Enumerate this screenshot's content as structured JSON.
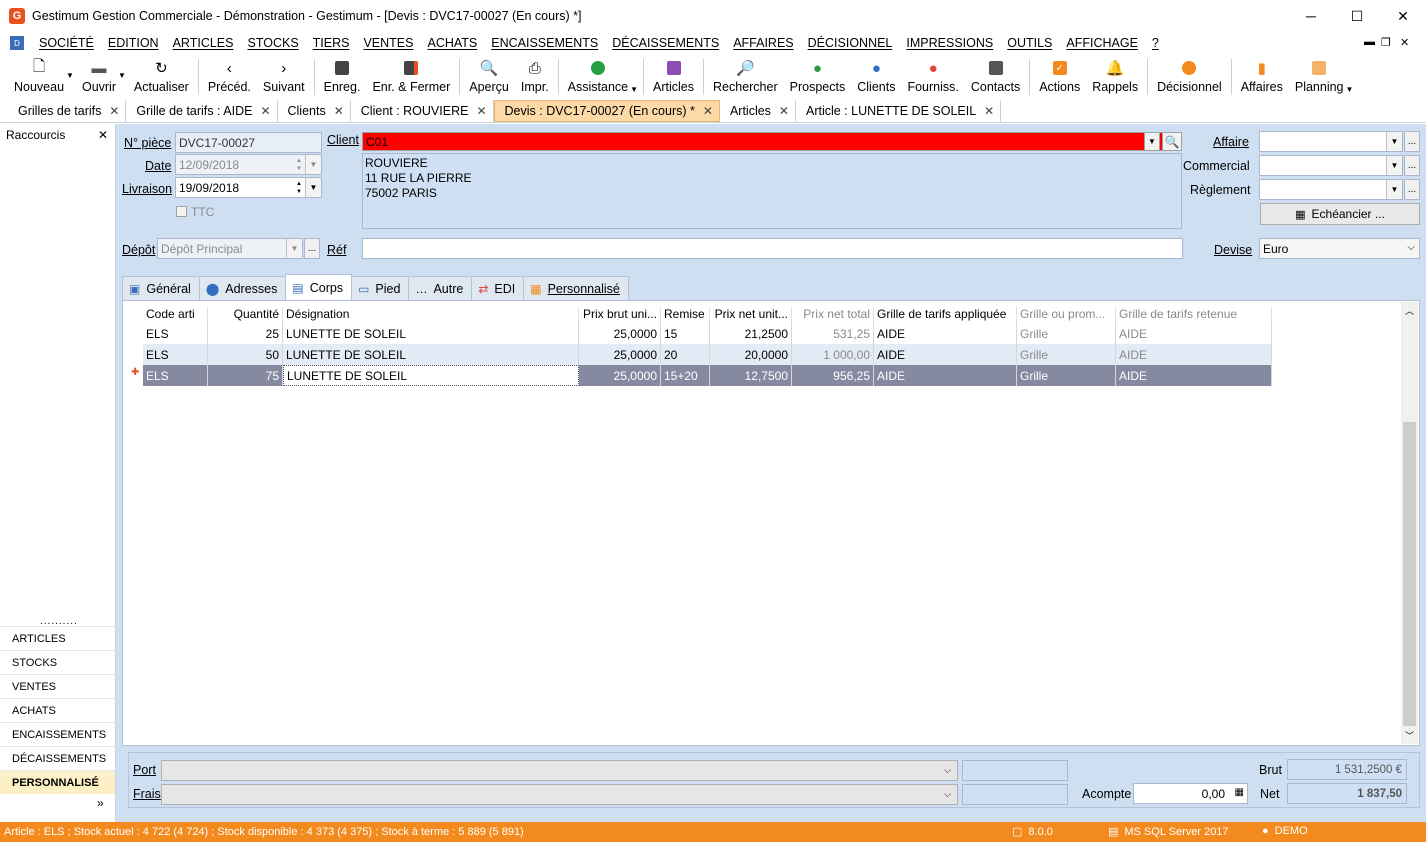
{
  "window": {
    "title": "Gestimum Gestion Commerciale - Démonstration - Gestimum - [Devis : DVC17-00027 (En cours) *]",
    "app_icon": "G"
  },
  "menu": [
    "SOCIÉTÉ",
    "EDITION",
    "ARTICLES",
    "STOCKS",
    "TIERS",
    "VENTES",
    "ACHATS",
    "ENCAISSEMENTS",
    "DÉCAISSEMENTS",
    "AFFAIRES",
    "DÉCISIONNEL",
    "IMPRESSIONS",
    "OUTILS",
    "AFFICHAGE",
    "?"
  ],
  "toolbar": {
    "nouveau": "Nouveau",
    "ouvrir": "Ouvrir",
    "actualiser": "Actualiser",
    "preced": "Précéd.",
    "suivant": "Suivant",
    "enreg": "Enreg.",
    "enr_fermer": "Enr. & Fermer",
    "apercu": "Aperçu",
    "impr": "Impr.",
    "assistance": "Assistance",
    "articles": "Articles",
    "rechercher": "Rechercher",
    "prospects": "Prospects",
    "clients": "Clients",
    "fourniss": "Fourniss.",
    "contacts": "Contacts",
    "actions": "Actions",
    "rappels": "Rappels",
    "decisionnel": "Décisionnel",
    "affaires": "Affaires",
    "planning": "Planning"
  },
  "doc_tabs": [
    "Grilles de tarifs",
    "Grille de tarifs : AIDE",
    "Clients",
    "Client : ROUVIERE",
    "Devis : DVC17-00027 (En cours) *",
    "Articles",
    "Article : LUNETTE DE SOLEIL"
  ],
  "left_panel": {
    "title": "Raccourcis",
    "grip": "..........",
    "items": [
      "ARTICLES",
      "STOCKS",
      "VENTES",
      "ACHATS",
      "ENCAISSEMENTS",
      "DÉCAISSEMENTS",
      "PERSONNALISÉ"
    ],
    "more": "»"
  },
  "form": {
    "npiece_label": "N° pièce",
    "npiece_value": "DVC17-00027",
    "date_label": "Date",
    "date_value": "12/09/2018",
    "livraison_label": "Livraison",
    "livraison_value": "19/09/2018",
    "ttc_label": "TTC",
    "client_label": "Client",
    "client_code": "C01",
    "client_address": [
      "ROUVIERE",
      "11 RUE LA PIERRE",
      "75002 PARIS"
    ],
    "affaire_label": "Affaire",
    "commercial_label": "Commercial",
    "reglement_label": "Règlement",
    "echeancier_label": "Echéancier ...",
    "depot_label": "Dépôt",
    "depot_value": "Dépôt Principal",
    "ref_label": "Réf",
    "devise_label": "Devise",
    "devise_value": "Euro"
  },
  "inner_tabs": [
    "Général",
    "Adresses",
    "Corps",
    "Pied",
    "Autre",
    "EDI",
    "Personnalisé"
  ],
  "grid": {
    "columns": [
      "Code arti",
      "Quantité",
      "Désignation",
      "Prix brut uni...",
      "Remise",
      "Prix net unit...",
      "Prix net total",
      "Grille de tarifs appliquée",
      "Grille ou prom...",
      "Grille de tarifs retenue"
    ],
    "rows": [
      [
        "ELS",
        "25",
        "LUNETTE DE SOLEIL",
        "25,0000",
        "15",
        "21,2500",
        "531,25",
        "AIDE",
        "Grille",
        "AIDE"
      ],
      [
        "ELS",
        "50",
        "LUNETTE DE SOLEIL",
        "25,0000",
        "20",
        "20,0000",
        "1 000,00",
        "AIDE",
        "Grille",
        "AIDE"
      ],
      [
        "ELS",
        "75",
        "LUNETTE DE SOLEIL",
        "25,0000",
        "15+20",
        "12,7500",
        "956,25",
        "AIDE",
        "Grille",
        "AIDE"
      ]
    ]
  },
  "footer": {
    "port_label": "Port",
    "frais_label": "Frais",
    "acompte_label": "Acompte",
    "acompte_value": "0,00",
    "brut_label": "Brut",
    "brut_value": "1 531,2500 €",
    "net_label": "Net",
    "net_value": "1 837,50"
  },
  "status": {
    "text": "Article : ELS ; Stock actuel : 4 722 (4 724) ; Stock disponible : 4 373 (4 375) ; Stock à terme : 5 889 (5 891)",
    "version": "8.0.0",
    "db": "MS SQL Server 2017",
    "user": "DEMO"
  },
  "colors": {
    "accent": "#f28a1d",
    "form_bg": "#cfdff2",
    "client_code_bg": "#ff0000",
    "active_tab": "#fcd9a6",
    "selected_row": "#868aa0"
  }
}
